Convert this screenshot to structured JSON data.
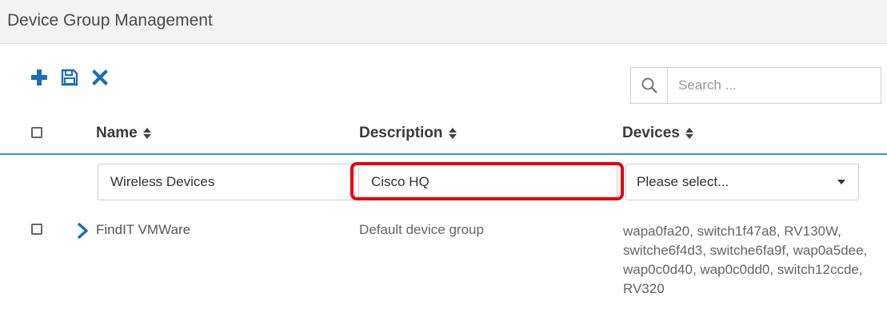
{
  "panel": {
    "title": "Device Group Management"
  },
  "toolbar": {
    "add_icon": "plus-icon",
    "save_icon": "floppy-disk-icon",
    "delete_icon": "x-icon",
    "accent_color": "#1a6fb5"
  },
  "search": {
    "placeholder": "Search ...",
    "value": ""
  },
  "table": {
    "columns": [
      {
        "label": "Name"
      },
      {
        "label": "Description"
      },
      {
        "label": "Devices"
      }
    ],
    "edit_row": {
      "name_value": "Wireless Devices",
      "description_value": "Cisco HQ",
      "devices_select": "Please select..."
    },
    "rows": [
      {
        "name": "FindIT VMWare",
        "description": "Default device group",
        "devices": "wapa0fa20, switch1f47a8, RV130W, switche6f4d3, switche6fa9f, wap0a5dee, wap0c0d40, wap0c0dd0, switch12ccde, RV320"
      }
    ]
  },
  "highlight_color": "#e3000f"
}
